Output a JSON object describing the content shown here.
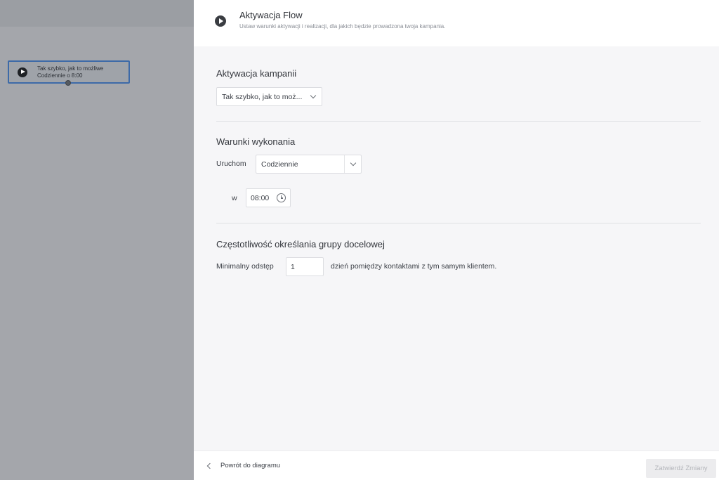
{
  "canvas": {
    "node": {
      "line1": "Tak szybko, jak to możliwe",
      "line2": "Codziennie o 8:00"
    }
  },
  "panel": {
    "title": "Aktywacja Flow",
    "subtitle": "Ustaw warunki aktywacji i realizacji, dla jakich będzie prowadzona twoja kampania.",
    "activation": {
      "heading": "Aktywacja kampanii",
      "select_value": "Tak szybko, jak to moż..."
    },
    "conditions": {
      "heading": "Warunki wykonania",
      "run_label": "Uruchom",
      "run_value": "Codziennie",
      "at_label": "w",
      "time_value": "08:00"
    },
    "frequency": {
      "heading": "Częstotliwość określania grupy docelowej",
      "min_label": "Minimalny odstęp",
      "min_value": "1",
      "suffix": "dzień pomiędzy kontaktami z tym samym klientem."
    },
    "footer": {
      "back_label": "Powrót do diagramu",
      "confirm_label": "Zatwierdź Zmiany"
    }
  },
  "colors": {
    "overlay": "#a4a6ab",
    "node_border": "#3d6aa8",
    "panel_bg": "#f6f6f8"
  },
  "icons": [
    "play-icon",
    "chevron-down-icon",
    "clock-icon",
    "chevron-left-icon"
  ]
}
